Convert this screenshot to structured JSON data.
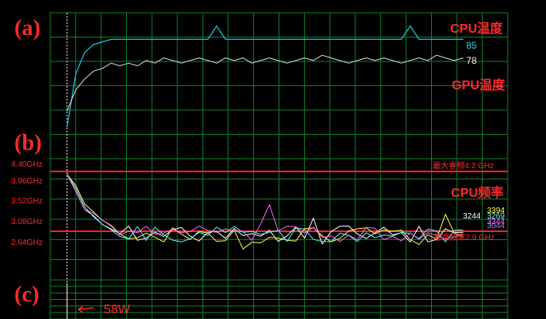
{
  "panels": {
    "a": {
      "letter_label": "(a)",
      "cpu_temp_label": "CPU温度",
      "gpu_temp_label": "GPU温度",
      "cpu_temp_value": "85",
      "gpu_temp_value": "78"
    },
    "b": {
      "letter_label": "(b)",
      "y_ticks": [
        "4.40GHz",
        "3.96GHz",
        "3.52GHz",
        "3.08GHz",
        "2.64GHz"
      ],
      "max_freq_label": "最大睿频4.2 GHz",
      "base_freq_label": "基准频率2.9 GHz",
      "cpu_freq_label": "CPU频率",
      "value_labels": [
        "3394",
        "3244",
        "3269",
        "3344",
        "3044"
      ]
    },
    "c": {
      "letter_label": "(c)",
      "power_marker_label": "58W"
    }
  },
  "colors": {
    "grid": "#0f7f2f",
    "gridline_border": "#0f6f2a",
    "red": "#ff2424",
    "cyan": "#18b7c7",
    "white": "#ffffff",
    "gpu_line": "#dcdcdc",
    "freq_colors": [
      "#ffffff",
      "#ffff4d",
      "#4dffff",
      "#ff66ff",
      "#8fb4ff",
      "#7fff7f",
      "#ffa14d"
    ]
  },
  "chart_data": [
    {
      "type": "line",
      "series": [
        {
          "name": "CPU温度",
          "values": [
            52,
            72,
            80,
            83,
            84,
            85,
            85,
            85,
            85,
            85,
            85,
            85,
            85,
            85,
            85,
            85,
            85,
            90,
            85,
            85,
            85,
            85,
            85,
            85,
            85,
            85,
            85,
            85,
            85,
            85,
            85,
            85,
            85,
            85,
            85,
            85,
            85,
            85,
            85,
            90,
            85,
            85,
            85,
            85,
            85,
            85
          ]
        },
        {
          "name": "GPU温度",
          "values": [
            58,
            66,
            70,
            73,
            74,
            76,
            75,
            76,
            75,
            77,
            76,
            78,
            77,
            76,
            77,
            78,
            77,
            76,
            78,
            77,
            78,
            76,
            77,
            78,
            77,
            76,
            77,
            78,
            77,
            79,
            78,
            77,
            76,
            77,
            78,
            77,
            78,
            77,
            76,
            77,
            78,
            77,
            79,
            78,
            77,
            78
          ]
        }
      ]
    },
    {
      "type": "line",
      "series": [
        {
          "name": "CPU频率",
          "values": [
            4.2,
            3.95,
            3.72,
            3.58,
            3.46,
            3.42,
            3.36,
            3.34,
            3.33,
            3.31,
            3.3,
            3.29,
            3.31,
            3.3,
            3.29,
            3.3,
            3.28,
            3.29,
            3.3,
            3.31,
            3.29,
            3.3,
            3.28,
            3.29,
            3.3,
            3.31,
            3.3,
            3.29,
            3.3,
            3.28,
            3.29,
            3.3,
            3.31,
            3.29,
            3.3,
            3.31,
            3.29,
            3.3,
            3.28,
            3.29,
            3.3,
            3.31,
            3.29,
            3.3,
            3.28,
            3.29
          ]
        }
      ]
    }
  ]
}
